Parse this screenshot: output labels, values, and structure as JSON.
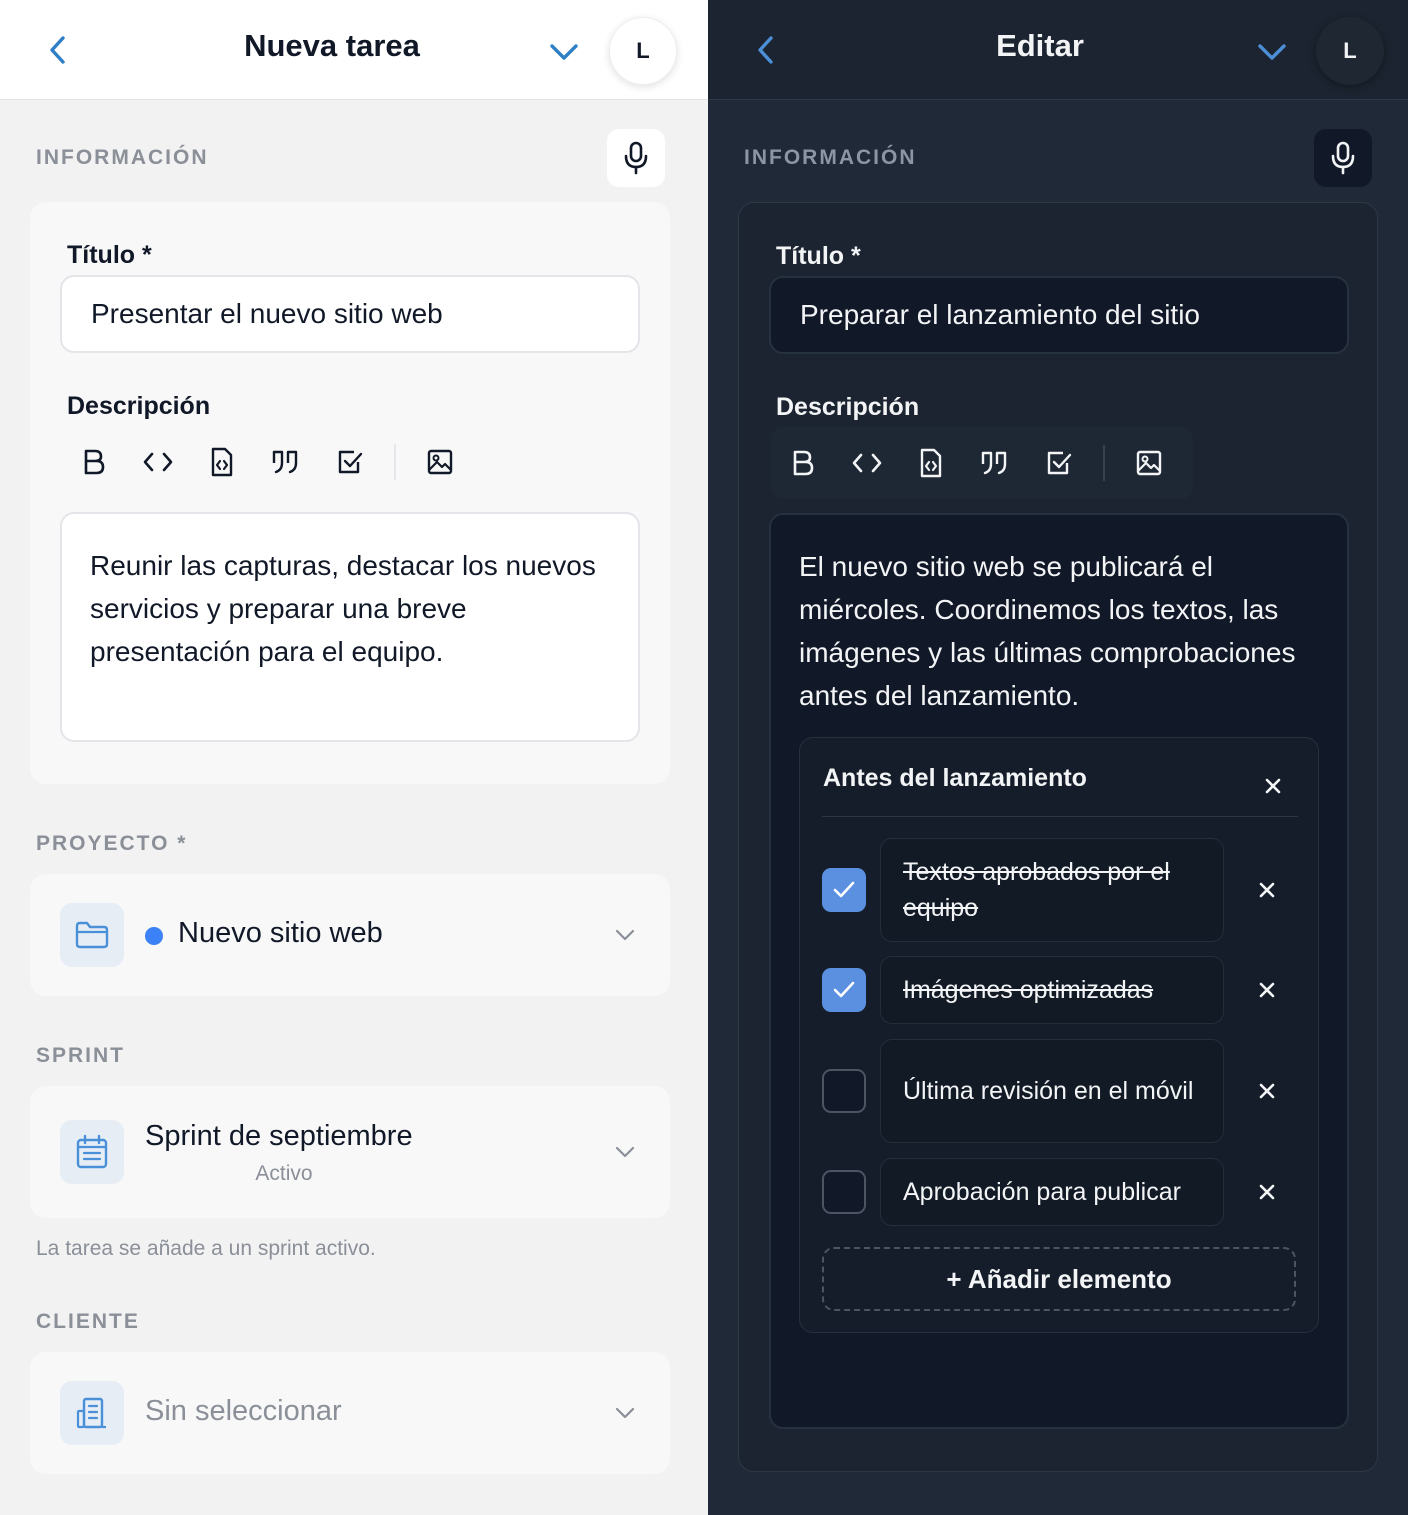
{
  "light": {
    "header": {
      "title": "Nueva tarea",
      "avatar": "L"
    },
    "info_label": "INFORMACIÓN",
    "title_label": "Título *",
    "title_value": "Presentar el nuevo sitio web",
    "description_label": "Descripción",
    "description_value": "Reunir las capturas, destacar los nuevos servicios y preparar una breve presentación para el equipo.",
    "project": {
      "label": "PROYECTO *",
      "value": "Nuevo sitio web",
      "dot_color": "#3b82f6"
    },
    "sprint": {
      "label": "SPRINT",
      "name": "Sprint de septiembre",
      "status": "Activo",
      "helper": "La tarea se añade a un sprint activo."
    },
    "client": {
      "label": "CLIENTE",
      "placeholder": "Sin seleccionar"
    }
  },
  "dark": {
    "header": {
      "title": "Editar",
      "avatar": "L"
    },
    "info_label": "INFORMACIÓN",
    "title_label": "Título *",
    "title_value": "Preparar el lanzamiento del sitio",
    "description_label": "Descripción",
    "description_value": "El nuevo sitio web se publicará el miércoles. Coordinemos los textos, las imágenes y las últimas comprobaciones antes del lanzamiento.",
    "checklist": {
      "title": "Antes del lanzamiento",
      "items": [
        {
          "text": "Textos aprobados por el equipo",
          "checked": true
        },
        {
          "text": "Imágenes optimizadas",
          "checked": true
        },
        {
          "text": "Última revisión en el móvil",
          "checked": false
        },
        {
          "text": "Aprobación para publicar",
          "checked": false
        }
      ],
      "add_label": "+ Añadir elemento"
    }
  },
  "toolbar_icons": [
    "bold-icon",
    "code-icon",
    "code-file-icon",
    "quote-icon",
    "checkbox-icon",
    "image-icon"
  ],
  "colors": {
    "accent": "#3b82f6",
    "accent_dark": "#5b8fe0",
    "dark_bg": "#1f2937"
  }
}
